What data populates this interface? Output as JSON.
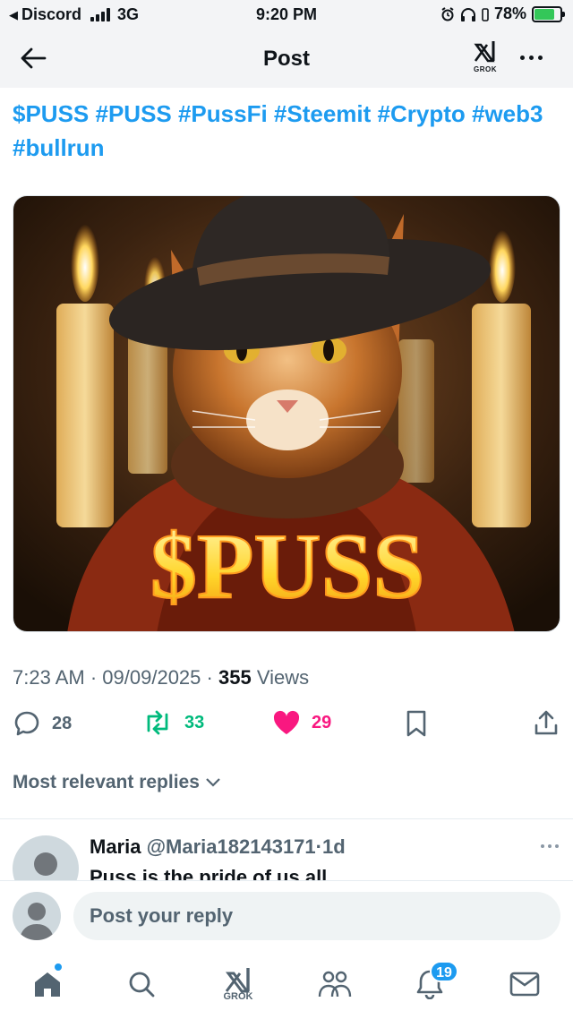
{
  "status_bar": {
    "back_app": "Discord",
    "network": "3G",
    "time": "9:20 PM",
    "battery": "78%",
    "battery_level": 0.78
  },
  "header": {
    "title": "Post",
    "grok_label": "GROK"
  },
  "post": {
    "text": "$PUSS #PUSS #PussFi #Steemit #Crypto #web3 #bullrun",
    "image_caption_text": "$PUSS",
    "time": "7:23 AM",
    "date": "09/09/2025",
    "views_count": "355",
    "views_label": "Views",
    "separator": "·"
  },
  "actions": {
    "replies": "28",
    "reposts": "33",
    "likes": "29"
  },
  "replies_section": {
    "sort_label": "Most relevant replies"
  },
  "reply": {
    "name": "Maria",
    "handle": "@Maria182143171",
    "age": "1d",
    "separator": "·",
    "text": "Puss is the pride of us all"
  },
  "composer": {
    "placeholder": "Post your reply"
  },
  "bottom_nav": {
    "grok_label": "GROK",
    "notifications_count": "19"
  },
  "colors": {
    "accent": "#1d9bf0",
    "repost": "#00ba7c",
    "like": "#f91880",
    "secondary_text": "#536471"
  }
}
